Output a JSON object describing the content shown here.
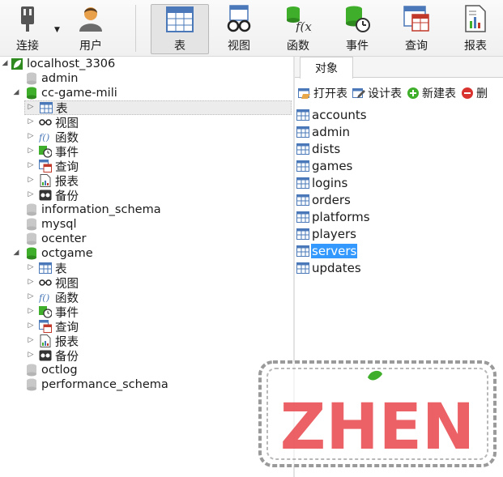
{
  "toolbar": {
    "connect": "连接",
    "user": "用户",
    "table": "表",
    "view": "视图",
    "function": "函数",
    "event": "事件",
    "query": "查询",
    "report": "报表"
  },
  "tree": {
    "connection": "localhost_3306",
    "db_admin": "admin",
    "db_ccgame": "cc-game-mili",
    "db_ccgame_children": [
      "表",
      "视图",
      "函数",
      "事件",
      "查询",
      "报表",
      "备份"
    ],
    "db_information_schema": "information_schema",
    "db_mysql": "mysql",
    "db_ocenter": "ocenter",
    "db_octgame": "octgame",
    "db_octgame_children": [
      "表",
      "视图",
      "函数",
      "事件",
      "查询",
      "报表",
      "备份"
    ],
    "db_octlog": "octlog",
    "db_performance_schema": "performance_schema"
  },
  "objects": {
    "tab_label": "对象",
    "open_table": "打开表",
    "design_table": "设计表",
    "new_table": "新建表",
    "delete_table_partial": "删",
    "tables": [
      "accounts",
      "admin",
      "dists",
      "games",
      "logins",
      "orders",
      "platforms",
      "players",
      "servers",
      "updates"
    ],
    "selected": "servers"
  },
  "watermark": {
    "text": "ZHEN"
  },
  "colors": {
    "selection": "#3399ff",
    "db_green": "#3fae2a",
    "watermark_red": "#e8454a"
  }
}
